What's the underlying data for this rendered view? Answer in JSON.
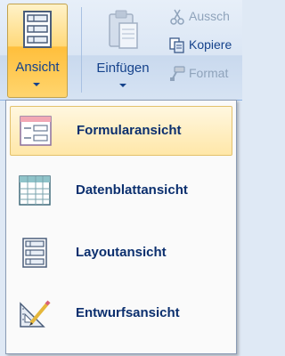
{
  "ribbon": {
    "view_button": {
      "label": "Ansicht",
      "icon": "layout-view-icon"
    },
    "paste_button": {
      "label": "Einfügen",
      "icon": "clipboard-icon"
    },
    "cut": {
      "label": "Aussch",
      "icon": "scissors-icon"
    },
    "copy": {
      "label": "Kopiere",
      "icon": "copy-icon"
    },
    "format_painter": {
      "label": "Format",
      "icon": "format-painter-icon"
    }
  },
  "menu": {
    "items": [
      {
        "label": "Formularansicht",
        "icon": "form-view-icon",
        "highlighted": true
      },
      {
        "label": "Datenblattansicht",
        "icon": "datasheet-view-icon",
        "highlighted": false
      },
      {
        "label": "Layoutansicht",
        "icon": "layout-view-icon",
        "highlighted": false
      },
      {
        "label": "Entwurfsansicht",
        "icon": "design-view-icon",
        "highlighted": false
      }
    ]
  },
  "colors": {
    "accent_text": "#15428b",
    "menu_text": "#0b2f6e",
    "highlight": "#ffe7a8"
  }
}
